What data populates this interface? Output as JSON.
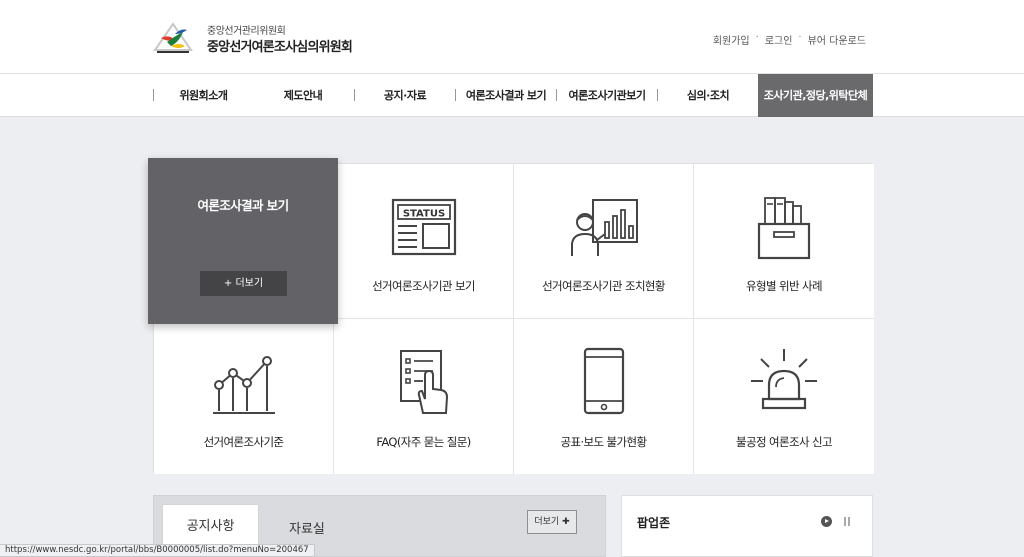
{
  "header": {
    "org_sub": "중앙선거관리위원회",
    "org_title": "중앙선거여론조사심의위원회",
    "util": [
      "회원가입",
      "로그인",
      "뷰어 다운로드"
    ]
  },
  "gnb": [
    "위원회소개",
    "제도안내",
    "공지·자료",
    "여론조사결과 보기",
    "여론조사기관보기",
    "심의·조치",
    "조사기관,정당,위탁단체"
  ],
  "feature": {
    "title": "여론조사결과 보기",
    "more": "+  더보기"
  },
  "tiles": [
    {
      "label": "선거여론조사기관 보기",
      "icon": "status-board-icon",
      "icon_text": "STATUS"
    },
    {
      "label": "선거여론조사기관 조치현황",
      "icon": "presenter-chart-icon"
    },
    {
      "label": "유형별 위반 사례",
      "icon": "archive-box-icon"
    },
    {
      "label": "선거여론조사기준",
      "icon": "line-chart-icon"
    },
    {
      "label": "FAQ(자주 묻는 질문)",
      "icon": "checklist-hand-icon"
    },
    {
      "label": "공표·보도 불가현황",
      "icon": "smartphone-icon"
    },
    {
      "label": "불공정 여론조사 신고",
      "icon": "siren-icon"
    }
  ],
  "notice": {
    "tab_notice": "공지사항",
    "tab_archive": "자료실",
    "more": "더보기 ✚"
  },
  "popup": {
    "title": "팝업존"
  },
  "status_url": "https://www.nesdc.go.kr/portal/bbs/B0000005/list.do?menuNo=200467"
}
